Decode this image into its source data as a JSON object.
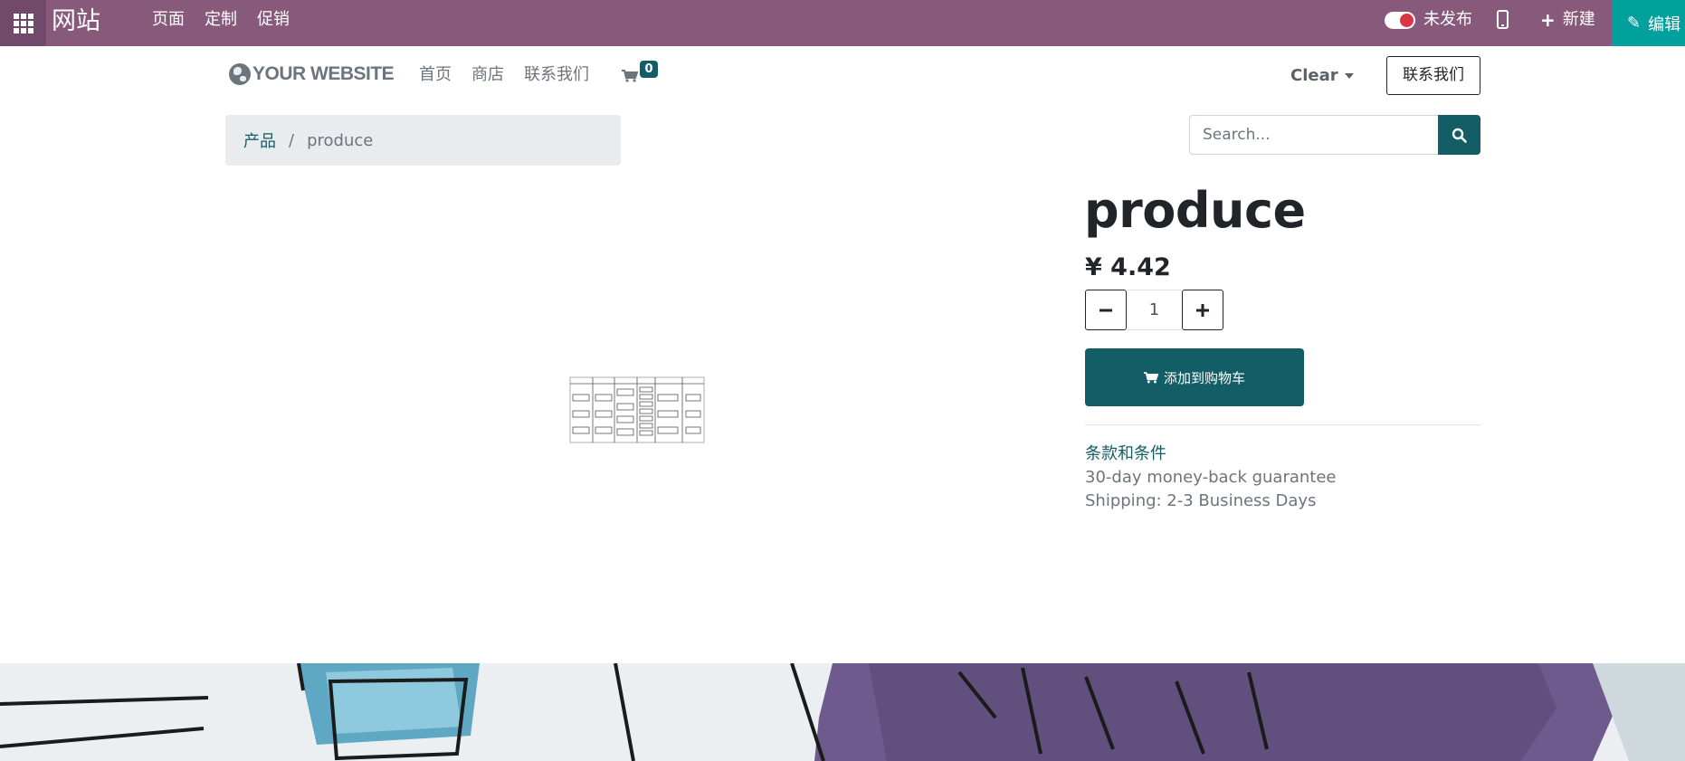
{
  "admin_bar": {
    "title": "网站",
    "menu": [
      "页面",
      "定制",
      "促销"
    ],
    "publish_label": "未发布",
    "new_label": "新建",
    "edit_label": "编辑"
  },
  "header": {
    "logo_text": "YOUR WEBSITE",
    "nav": [
      "首页",
      "商店",
      "联系我们"
    ],
    "cart_count": "0",
    "clear_label": "Clear",
    "contact_button": "联系我们"
  },
  "breadcrumb": {
    "link": "产品",
    "separator": "/",
    "current": "produce"
  },
  "search": {
    "placeholder": "Search..."
  },
  "product": {
    "name": "produce",
    "price": "¥ 4.42",
    "quantity": "1",
    "add_to_cart": "添加到购物车",
    "terms_link": "条款和条件",
    "guarantee": "30-day money-back guarantee",
    "shipping": "Shipping: 2-3 Business Days"
  },
  "colors": {
    "admin_bar": "#875a7b",
    "edit_button": "#00a09d",
    "primary": "#135d66"
  },
  "icons": [
    "apps-grid-icon",
    "toggle-icon",
    "mobile-icon",
    "plus-icon",
    "pencil-icon",
    "globe-icon",
    "cart-icon",
    "search-icon",
    "minus-icon",
    "plus-icon",
    "cart-icon"
  ]
}
